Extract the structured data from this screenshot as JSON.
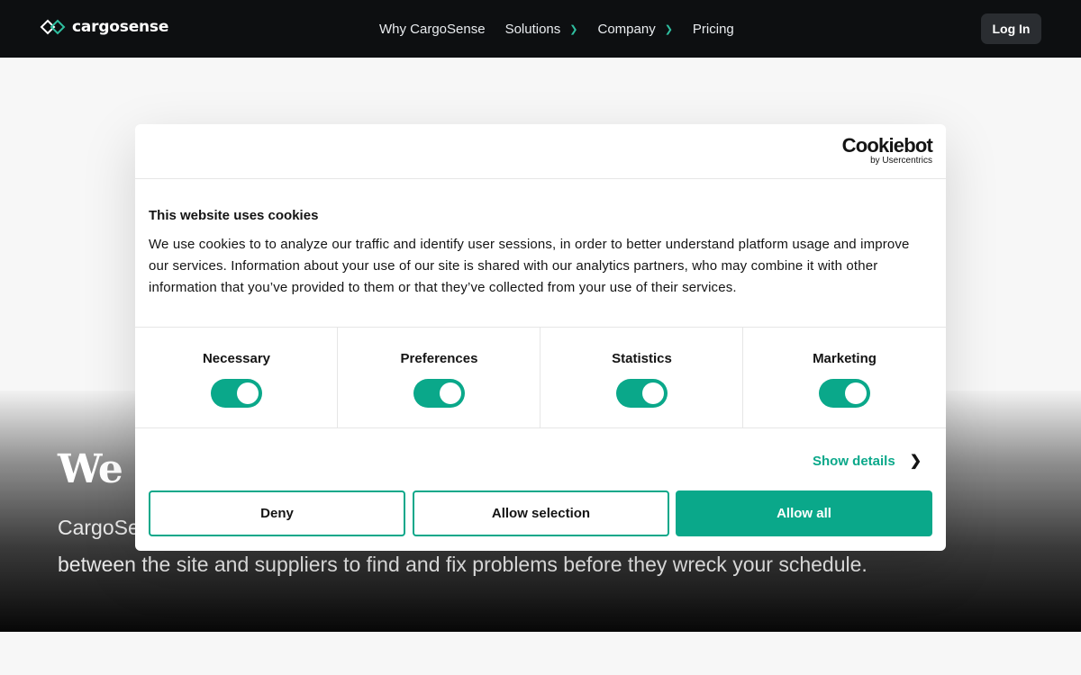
{
  "nav": {
    "logo_text": "cargosense",
    "links": [
      {
        "label": "Why CargoSense",
        "has_dropdown": false
      },
      {
        "label": "Solutions",
        "has_dropdown": true
      },
      {
        "label": "Company",
        "has_dropdown": true
      },
      {
        "label": "Pricing",
        "has_dropdown": false
      }
    ],
    "login_label": "Log In"
  },
  "hero": {
    "title_visible": "We I",
    "subtitle_line1_visible": "CargoSe",
    "subtitle_line2": "between the site and suppliers to find and fix problems before they wreck your schedule."
  },
  "cookie_dialog": {
    "brand_name": "Cookiebot",
    "brand_by": "by Usercentrics",
    "title": "This website uses cookies",
    "text": "We use cookies to to analyze our traffic and identify user sessions, in order to better understand platform usage and improve our services. Information about your use of our site is shared with our analytics partners, who may combine it with other information that you’ve provided to them or that they’ve collected from your use of their services.",
    "categories": [
      {
        "label": "Necessary",
        "enabled": true
      },
      {
        "label": "Preferences",
        "enabled": true
      },
      {
        "label": "Statistics",
        "enabled": true
      },
      {
        "label": "Marketing",
        "enabled": true
      }
    ],
    "show_details_label": "Show details",
    "buttons": {
      "deny": "Deny",
      "allow_selection": "Allow selection",
      "allow_all": "Allow all"
    }
  },
  "colors": {
    "accent": "#0aa88a",
    "nav_bg": "#0d0f11",
    "text": "#141414"
  }
}
